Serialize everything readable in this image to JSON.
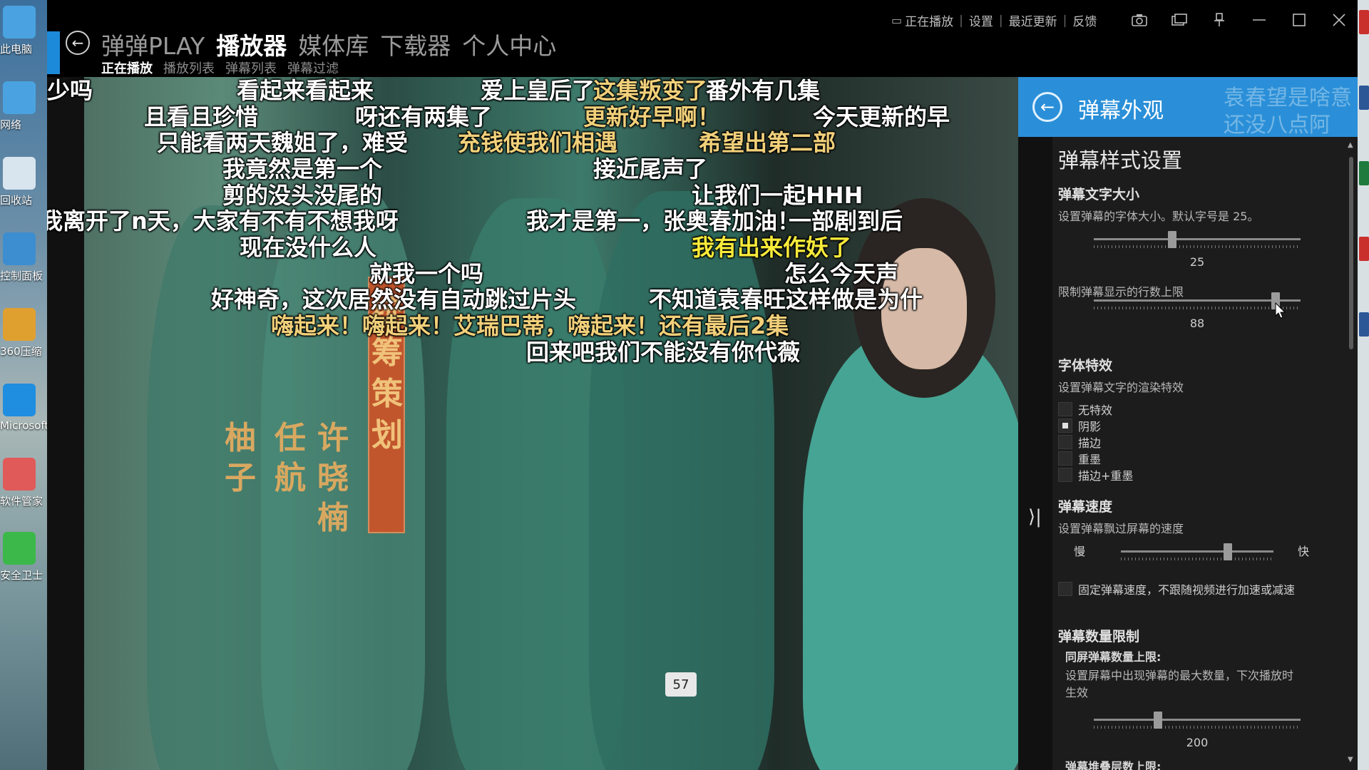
{
  "desktop": {
    "left_icons": [
      {
        "label": "此电脑",
        "color": "#4aa3e0"
      },
      {
        "label": "网络",
        "color": "#4aa3e0"
      },
      {
        "label": "回收站",
        "color": "#d8e4ee"
      },
      {
        "label": "控制面板",
        "color": "#3d8ed0"
      },
      {
        "label": "360压缩",
        "color": "#e0a030"
      },
      {
        "label": "Microsoft Edge",
        "color": "#1f8ee0"
      },
      {
        "label": "软件管家",
        "color": "#e05a5a"
      },
      {
        "label": "安全卫士",
        "color": "#3cb84a"
      }
    ],
    "right_tiles": [
      "#c9302c",
      "#2b5797",
      "#1f7a3d",
      "#c9302c",
      "#2b5797"
    ]
  },
  "app": {
    "nav": [
      "弹弹PLAY",
      "播放器",
      "媒体库",
      "下载器",
      "个人中心"
    ],
    "nav_active": "播放器",
    "subnav": [
      "正在播放",
      "播放列表",
      "弹幕列表",
      "弹幕过滤"
    ],
    "subnav_active": "正在播放",
    "toplinks": [
      "正在播放",
      "设置",
      "最近更新",
      "反馈"
    ],
    "window_controls": [
      "camera-icon",
      "pip-icon",
      "pin-icon",
      "minimize-icon",
      "maximize-icon",
      "close-icon"
    ]
  },
  "video": {
    "credits": {
      "col1": [
        "柚",
        "子"
      ],
      "col2": [
        "任",
        "航"
      ],
      "col3": [
        "许",
        "晓",
        "楠"
      ],
      "banner": [
        "统",
        "筹",
        "策",
        "划"
      ]
    },
    "danmaku": [
      {
        "text": "少吗",
        "style": "white"
      },
      {
        "text": "看起来看起来",
        "style": "white"
      },
      {
        "text": "爱上皇后了",
        "style": "white"
      },
      {
        "text": "这集叛变了",
        "style": "gold"
      },
      {
        "text": "番外有几集",
        "style": "white"
      },
      {
        "text": "且看且珍惜",
        "style": "white"
      },
      {
        "text": "呀还有两集了",
        "style": "white"
      },
      {
        "text": "更新好早啊！",
        "style": "gold"
      },
      {
        "text": "今天更新的早",
        "style": "white"
      },
      {
        "text": "只能看两天魏姐了，难受",
        "style": "white"
      },
      {
        "text": "充钱使我们相遇",
        "style": "gold"
      },
      {
        "text": "希望出第二部",
        "style": "gold"
      },
      {
        "text": "我竟然是第一个",
        "style": "white"
      },
      {
        "text": "接近尾声了",
        "style": "white"
      },
      {
        "text": "剪的没头没尾的",
        "style": "white"
      },
      {
        "text": "让我们一起HHH",
        "style": "white"
      },
      {
        "text": "我离开了n天，大家有不有不想我呀",
        "style": "white"
      },
      {
        "text": "我才是第一，张奥春加油！",
        "style": "white"
      },
      {
        "text": "一部剧到后",
        "style": "white"
      },
      {
        "text": "现在没什么人",
        "style": "white"
      },
      {
        "text": "我有出来作妖了",
        "style": "yellow"
      },
      {
        "text": "就我一个吗",
        "style": "white"
      },
      {
        "text": "怎么今天声",
        "style": "white"
      },
      {
        "text": "好神奇，这次居然没有自动跳过片头",
        "style": "white"
      },
      {
        "text": "不知道袁春旺这样做是为什",
        "style": "white"
      },
      {
        "text": "嗨起来！嗨起来！艾瑞巴蒂，嗨起来！还有最后2集",
        "style": "gold"
      },
      {
        "text": "回来吧我们不能没有你代薇",
        "style": "white"
      }
    ],
    "time_badge": "57"
  },
  "panel": {
    "title": "弹幕外观",
    "ghost_texts": [
      "袁春望是啥意",
      "还没八点阿"
    ],
    "style_settings_title": "弹幕样式设置",
    "font_size": {
      "title": "弹幕文字大小",
      "desc": "设置弹幕的字体大小。默认字号是 25。",
      "value": "25",
      "fraction": 0.38
    },
    "line_limit": {
      "desc": "限制弹幕显示的行数上限",
      "value": "88",
      "fraction": 0.88
    },
    "effects": {
      "title": "字体特效",
      "desc": "设置弹幕文字的渲染特效",
      "options": [
        "无特效",
        "阴影",
        "描边",
        "重墨",
        "描边+重墨"
      ],
      "selected": "阴影"
    },
    "speed": {
      "title": "弹幕速度",
      "desc": "设置弹幕飘过屏幕的速度",
      "slow": "慢",
      "fast": "快",
      "fraction": 0.7,
      "fixed_label": "固定弹幕速度，不跟随视频进行加速或减速"
    },
    "count_limit": {
      "title": "弹幕数量限制",
      "subtitle": "同屏弹幕数量上限:",
      "desc_line1": "设置屏幕中出现弹幕的最大数量，下次播放时",
      "desc_line2": "生效",
      "value": "200",
      "fraction": 0.31,
      "next_partial": "弹幕堆叠层数上限:"
    }
  }
}
